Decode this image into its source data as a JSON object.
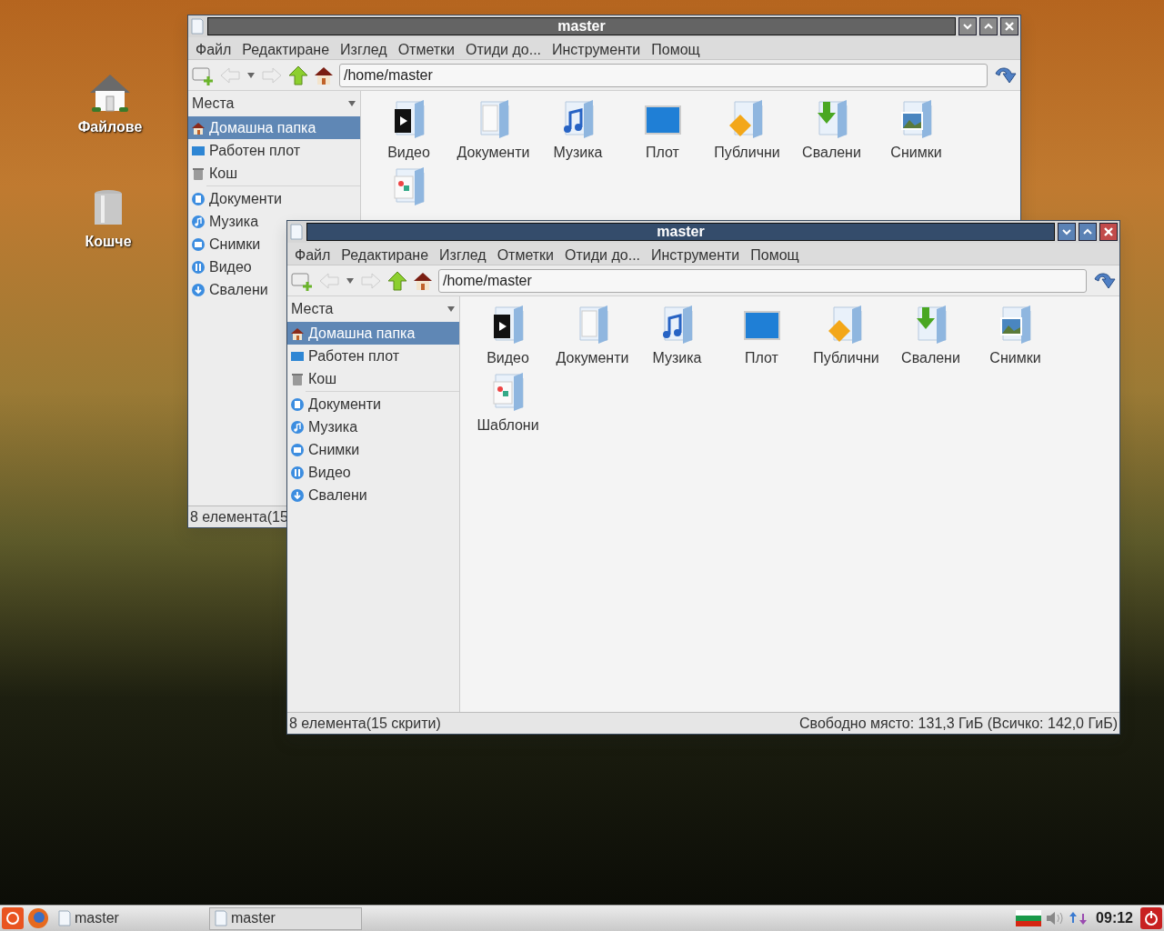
{
  "desktop_icons": [
    {
      "label": "Файлове",
      "kind": "home"
    },
    {
      "label": "Кошче",
      "kind": "trash"
    }
  ],
  "windows": [
    {
      "title": "master",
      "active": false,
      "menu": [
        "Файл",
        "Редактиране",
        "Изглед",
        "Отметки",
        "Отиди до...",
        "Инструменти",
        "Помощ"
      ],
      "path": "/home/master",
      "places_header": "Места",
      "places": [
        {
          "label": "Домашна папка",
          "kind": "home",
          "selected": true
        },
        {
          "label": "Работен плот",
          "kind": "desktop",
          "selected": false
        },
        {
          "label": "Кош",
          "kind": "trash",
          "selected": false
        }
      ],
      "bookmarks": [
        {
          "label": "Документи",
          "kind": "documents",
          "selected": false
        },
        {
          "label": "Музика",
          "kind": "music",
          "selected": false
        },
        {
          "label": "Снимки",
          "kind": "pictures",
          "selected": false
        },
        {
          "label": "Видео",
          "kind": "video",
          "selected": false
        },
        {
          "label": "Свалени",
          "kind": "download",
          "selected": false
        }
      ],
      "files": [
        {
          "label": "Видео",
          "kind": "video"
        },
        {
          "label": "Документи",
          "kind": "documents"
        },
        {
          "label": "Музика",
          "kind": "music"
        },
        {
          "label": "Плот",
          "kind": "desktop"
        },
        {
          "label": "Публични",
          "kind": "public"
        },
        {
          "label": "Свалени",
          "kind": "download"
        },
        {
          "label": "Снимки",
          "kind": "pictures"
        },
        {
          "kind": "templates"
        }
      ],
      "status_left": "8 елемента(15"
    },
    {
      "title": "master",
      "active": true,
      "menu": [
        "Файл",
        "Редактиране",
        "Изглед",
        "Отметки",
        "Отиди до...",
        "Инструменти",
        "Помощ"
      ],
      "path": "/home/master",
      "places_header": "Места",
      "places": [
        {
          "label": "Домашна папка",
          "kind": "home",
          "selected": true
        },
        {
          "label": "Работен плот",
          "kind": "desktop",
          "selected": false
        },
        {
          "label": "Кош",
          "kind": "trash",
          "selected": false
        }
      ],
      "bookmarks": [
        {
          "label": "Документи",
          "kind": "documents",
          "selected": false
        },
        {
          "label": "Музика",
          "kind": "music",
          "selected": false
        },
        {
          "label": "Снимки",
          "kind": "pictures",
          "selected": false
        },
        {
          "label": "Видео",
          "kind": "video",
          "selected": false
        },
        {
          "label": "Свалени",
          "kind": "download",
          "selected": false
        }
      ],
      "files": [
        {
          "label": "Видео",
          "kind": "video"
        },
        {
          "label": "Документи",
          "kind": "documents"
        },
        {
          "label": "Музика",
          "kind": "music"
        },
        {
          "label": "Плот",
          "kind": "desktop"
        },
        {
          "label": "Публични",
          "kind": "public"
        },
        {
          "label": "Свалени",
          "kind": "download"
        },
        {
          "label": "Снимки",
          "kind": "pictures"
        },
        {
          "label": "Шаблони",
          "kind": "templates"
        }
      ],
      "status_left": "8 елемента(15 скрити)",
      "status_right": "Свободно място: 131,3 ГиБ (Всичко: 142,0 ГиБ)"
    }
  ],
  "taskbar": {
    "tasks": [
      {
        "title": "master",
        "selected": false
      },
      {
        "title": "master",
        "selected": true
      }
    ],
    "clock": "09:12"
  }
}
